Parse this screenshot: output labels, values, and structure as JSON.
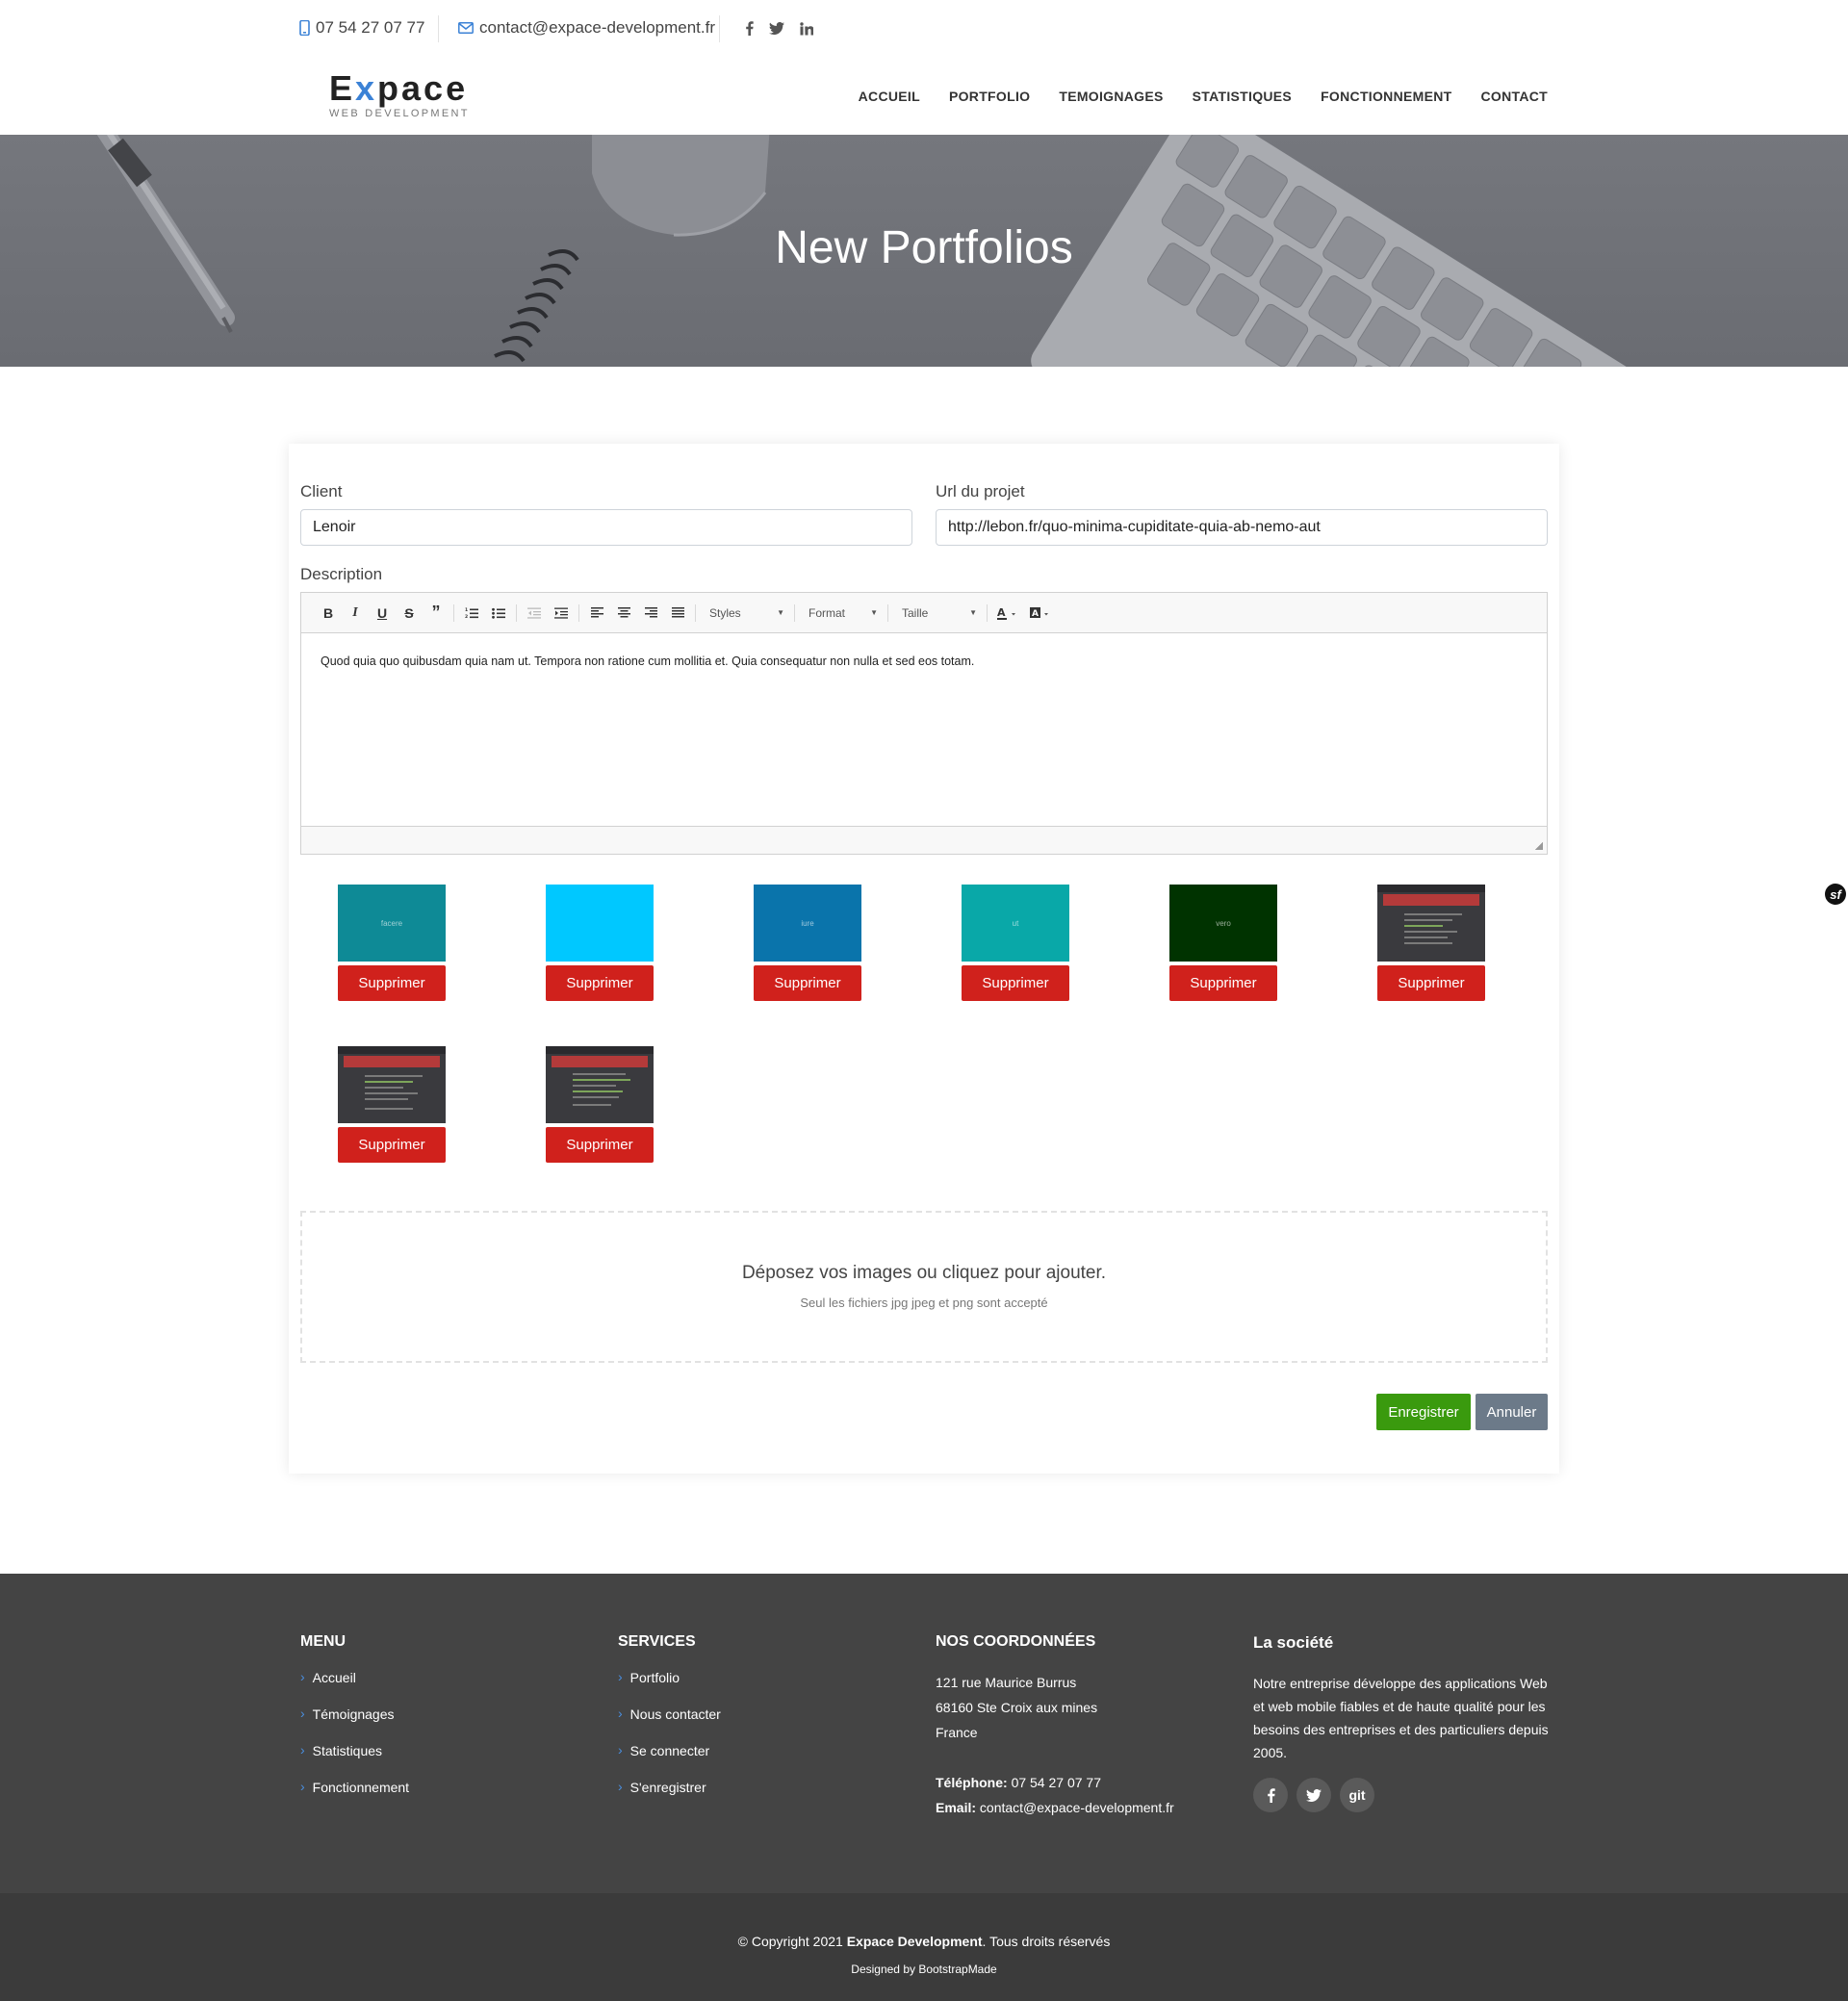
{
  "topbar": {
    "phone": "07 54 27 07 77",
    "email": "contact@expace-development.fr",
    "socials": [
      "facebook-icon",
      "twitter-icon",
      "linkedin-icon"
    ]
  },
  "brand": {
    "name_pre": "E",
    "name_x": "x",
    "name_post": "pace",
    "tagline": "WEB DEVELOPMENT",
    "accent": "#3b82d6"
  },
  "nav": [
    "ACCUEIL",
    "PORTFOLIO",
    "TEMOIGNAGES",
    "STATISTIQUES",
    "FONCTIONNEMENT",
    "CONTACT"
  ],
  "hero": {
    "title": "New Portfolios"
  },
  "form": {
    "client_label": "Client",
    "client_value": "Lenoir",
    "url_label": "Url du projet",
    "url_value": "http://lebon.fr/quo-minima-cupiditate-quia-ab-nemo-aut",
    "description_label": "Description",
    "toolbar": {
      "styles": "Styles",
      "format": "Format",
      "size": "Taille"
    },
    "description_text": "Quod quia quo quibusdam quia nam ut. Tempora non ratione cum mollitia et. Quia consequatur non nulla et sed eos totam."
  },
  "images": [
    {
      "kind": "color",
      "color": "#0e8a96",
      "caption": "facere"
    },
    {
      "kind": "color",
      "color": "#00c8ff",
      "caption": ""
    },
    {
      "kind": "color",
      "color": "#0a74ab",
      "caption": "iure"
    },
    {
      "kind": "color",
      "color": "#09a8a8",
      "caption": "ut"
    },
    {
      "kind": "color",
      "color": "#003300",
      "caption": "vero"
    },
    {
      "kind": "screenshot",
      "color": "#3a3a3e",
      "caption": ""
    },
    {
      "kind": "screenshot",
      "color": "#3a3a3e",
      "caption": ""
    },
    {
      "kind": "screenshot",
      "color": "#3a3a3e",
      "caption": ""
    }
  ],
  "delete_label": "Supprimer",
  "dropzone": {
    "main": "Déposez vos images ou cliquez pour ajouter.",
    "hint": "Seul les fichiers jpg jpeg et png sont accepté"
  },
  "actions": {
    "save": "Enregistrer",
    "cancel": "Annuler",
    "save_color": "#3a9a0e",
    "cancel_color": "#6c7a89"
  },
  "footer": {
    "menu": {
      "title": "MENU",
      "items": [
        "Accueil",
        "Témoignages",
        "Statistiques",
        "Fonctionnement"
      ]
    },
    "services": {
      "title": "SERVICES",
      "items": [
        "Portfolio",
        "Nous contacter",
        "Se connecter",
        "S'enregistrer"
      ]
    },
    "contact": {
      "title": "NOS COORDONNÉES",
      "address1": "121 rue Maurice Burrus",
      "address2": "68160 Ste Croix aux mines",
      "address3": "France",
      "phone_label": "Téléphone:",
      "phone": "07 54 27 07 77",
      "email_label": "Email:",
      "email": "contact@expace-development.fr"
    },
    "about": {
      "title": "La société",
      "text": "Notre entreprise développe des applications Web et web mobile fiables et de haute qualité pour les besoins des entreprises et des particuliers depuis 2005.",
      "socials": [
        "facebook-icon",
        "twitter-icon",
        "git-icon"
      ],
      "git_label": "git"
    },
    "copyright_pre": "© Copyright 2021",
    "copyright_brand": "Expace Development",
    "copyright_post": ". Tous droits réservés",
    "designed": "Designed by BootstrapMade"
  }
}
